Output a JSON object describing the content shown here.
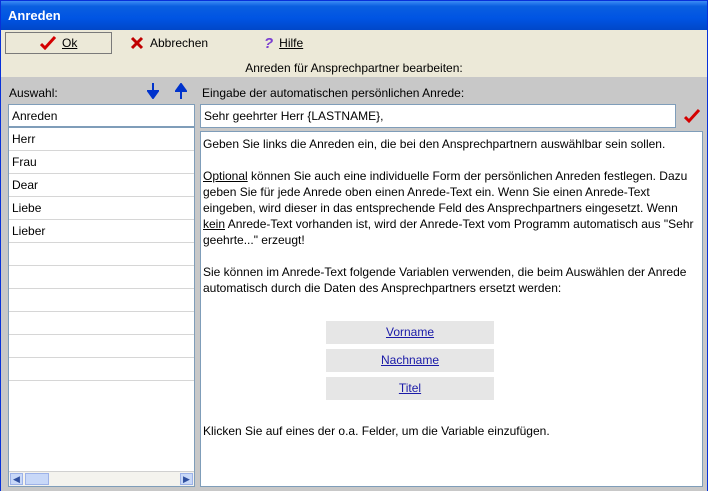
{
  "window": {
    "title": "Anreden"
  },
  "toolbar": {
    "ok_label": "Ok",
    "cancel_label": "Abbrechen",
    "help_label": "Hilfe"
  },
  "heading": "Anreden für Ansprechpartner bearbeiten:",
  "left": {
    "label": "Auswahl:",
    "items": [
      "Anreden",
      "Herr",
      "Frau",
      "Dear",
      "Liebe",
      "Lieber",
      "",
      "",
      "",
      "",
      "",
      ""
    ]
  },
  "right": {
    "label": "Eingabe der automatischen persönlichen Anrede:",
    "input_value": "Sehr geehrter Herr {LASTNAME},",
    "info": {
      "p1": "Geben Sie links die Anreden ein, die bei den Ansprechpartnern auswählbar sein sollen.",
      "p2_optional": "Optional",
      "p2_a": " können Sie auch eine individuelle Form der persönlichen Anreden festlegen. Dazu geben Sie für jede Anrede oben einen Anrede-Text ein. Wenn Sie einen Anrede-Text eingeben, wird dieser in das entsprechende Feld des Ansprechpartners eingesetzt. Wenn ",
      "p2_kein": "kein",
      "p2_b": " Anrede-Text vorhanden ist, wird der Anrede-Text vom Programm automatisch aus \"Sehr geehrte...\" erzeugt!",
      "p3": "Sie können im Anrede-Text folgende Variablen verwenden, die beim Auswählen der Anrede automatisch durch die Daten des Ansprechpartners ersetzt werden:",
      "variables": [
        "Vorname",
        "Nachname",
        "Titel"
      ],
      "p4": "Klicken Sie auf eines der o.a. Felder, um die Variable einzufügen."
    }
  },
  "colors": {
    "titlebar": "#0054e3",
    "accent_red": "#d40000",
    "arrow_blue": "#0033cc"
  }
}
